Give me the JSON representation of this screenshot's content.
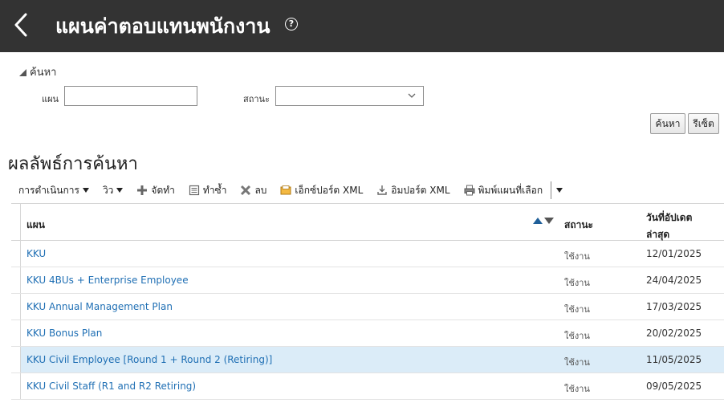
{
  "header": {
    "title": "แผนค่าตอบแทนพนักงาน",
    "help_glyph": "?"
  },
  "search": {
    "toggle_label": "ค้นหา",
    "plan_label": "แผน",
    "plan_value": "",
    "status_label": "สถานะ",
    "status_value": "",
    "search_button": "ค้นหา",
    "reset_button": "รีเซ็ต"
  },
  "results": {
    "title": "ผลลัพธ์การค้นหา"
  },
  "toolbar": {
    "actions_label": "การดำเนินการ",
    "view_label": "วิว",
    "manage_label": "จัดทำ",
    "duplicate_label": "ทำซ้ำ",
    "delete_label": "ลบ",
    "export_label": "เอ็กซ์ปอร์ต XML",
    "import_label": "อิมปอร์ต XML",
    "print_label": "พิมพ์แผนที่เลือก"
  },
  "table": {
    "columns": {
      "plan": "แผน",
      "status": "สถานะ",
      "updated_line1": "วันที่อัปเดต",
      "updated_line2": "ล่าสุด"
    },
    "rows": [
      {
        "plan": "KKU",
        "status": "ใช้งาน",
        "date": "12/01/2025"
      },
      {
        "plan": "KKU 4BUs + Enterprise Employee",
        "status": "ใช้งาน",
        "date": "24/04/2025"
      },
      {
        "plan": "KKU Annual Management Plan",
        "status": "ใช้งาน",
        "date": "17/03/2025"
      },
      {
        "plan": "KKU Bonus Plan",
        "status": "ใช้งาน",
        "date": "20/02/2025"
      },
      {
        "plan": "KKU Civil Employee [Round 1 + Round 2 (Retiring)]",
        "status": "ใช้งาน",
        "date": "11/05/2025"
      },
      {
        "plan": "KKU Civil Staff (R1 and R2 Retiring)",
        "status": "ใช้งาน",
        "date": "09/05/2025"
      }
    ]
  },
  "colors": {
    "header_bg": "#333333",
    "link": "#1f6fb4",
    "selected_row": "#dbecf8"
  }
}
